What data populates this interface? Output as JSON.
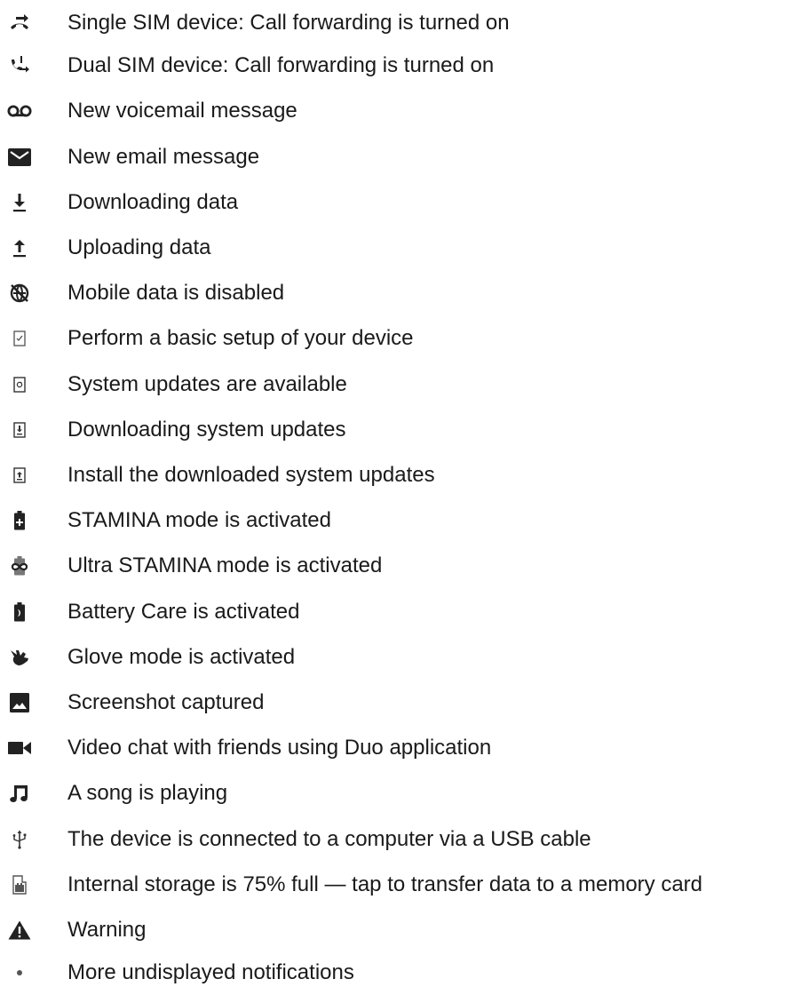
{
  "items": [
    {
      "icon": "call-forwarding-single-sim-icon",
      "label": "Single SIM device: Call forwarding is turned on"
    },
    {
      "icon": "call-forwarding-dual-sim-icon",
      "label": "Dual SIM device: Call forwarding is turned on"
    },
    {
      "icon": "voicemail-icon",
      "label": "New voicemail message"
    },
    {
      "icon": "email-icon",
      "label": "New email message"
    },
    {
      "icon": "download-icon",
      "label": "Downloading data"
    },
    {
      "icon": "upload-icon",
      "label": "Uploading data"
    },
    {
      "icon": "mobile-data-disabled-icon",
      "label": "Mobile data is disabled"
    },
    {
      "icon": "basic-setup-icon",
      "label": "Perform a basic setup of your device"
    },
    {
      "icon": "system-update-available-icon",
      "label": "System updates are available"
    },
    {
      "icon": "downloading-system-update-icon",
      "label": "Downloading system updates"
    },
    {
      "icon": "install-system-update-icon",
      "label": "Install the downloaded system updates"
    },
    {
      "icon": "stamina-mode-icon",
      "label": "STAMINA mode is activated"
    },
    {
      "icon": "ultra-stamina-mode-icon",
      "label": "Ultra STAMINA mode is activated"
    },
    {
      "icon": "battery-care-icon",
      "label": "Battery Care is activated"
    },
    {
      "icon": "glove-mode-icon",
      "label": "Glove mode is activated"
    },
    {
      "icon": "screenshot-icon",
      "label": "Screenshot captured"
    },
    {
      "icon": "video-chat-icon",
      "label": "Video chat with friends using Duo application"
    },
    {
      "icon": "music-note-icon",
      "label": "A song is playing"
    },
    {
      "icon": "usb-icon",
      "label": "The device is connected to a computer via a USB cable"
    },
    {
      "icon": "storage-full-icon",
      "label": "Internal storage is 75% full — tap to transfer data to a memory card"
    },
    {
      "icon": "warning-icon",
      "label": "Warning"
    },
    {
      "icon": "more-notifications-dot-icon",
      "label": "More undisplayed notifications"
    }
  ]
}
